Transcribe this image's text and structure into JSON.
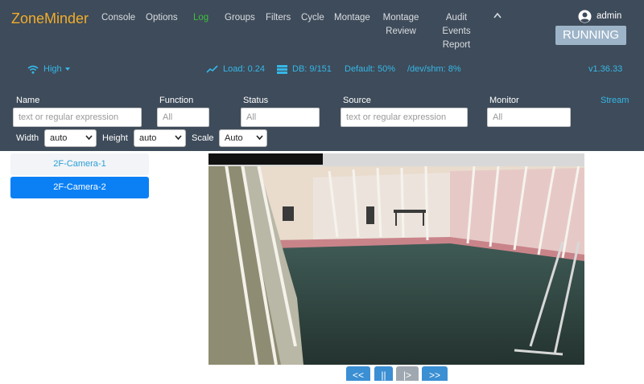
{
  "app": {
    "brand": "ZoneMinder",
    "version": "v1.36.33"
  },
  "nav": {
    "console": "Console",
    "options": "Options",
    "log": "Log",
    "groups": "Groups",
    "filters": "Filters",
    "cycle": "Cycle",
    "montage": "Montage",
    "montage_review": "Montage Review",
    "audit_events_report": "Audit Events Report"
  },
  "user": {
    "name": "admin",
    "icon": "account-circle-icon"
  },
  "state": {
    "running_label": "RUNNING"
  },
  "status": {
    "bandwidth": "High",
    "load": "Load: 0.24",
    "db": "DB: 9/151",
    "default_storage": "Default: 50%",
    "shm": "/dev/shm: 8%"
  },
  "filters": {
    "name_label": "Name",
    "name_placeholder": "text or regular expression",
    "function_label": "Function",
    "function_placeholder": "All",
    "status_label": "Status",
    "status_placeholder": "All",
    "source_label": "Source",
    "source_placeholder": "text or regular expression",
    "monitor_label": "Monitor",
    "monitor_placeholder": "All",
    "stream_link": "Stream",
    "width_label": "Width",
    "width_value": "auto",
    "height_label": "Height",
    "height_value": "auto",
    "scale_label": "Scale",
    "scale_value": "Auto"
  },
  "cameras": [
    {
      "label": "2F-Camera-1",
      "active": false
    },
    {
      "label": "2F-Camera-2",
      "active": true
    }
  ],
  "controls": {
    "rewind": "<<",
    "pause": "||",
    "play": "|>",
    "fast_forward": ">>"
  },
  "colors": {
    "header_bg": "#3e4b5a",
    "brand": "#f0ad2c",
    "active_nav": "#3fbf3f",
    "link": "#35b8e8",
    "selected_camera": "#0b80f5"
  }
}
